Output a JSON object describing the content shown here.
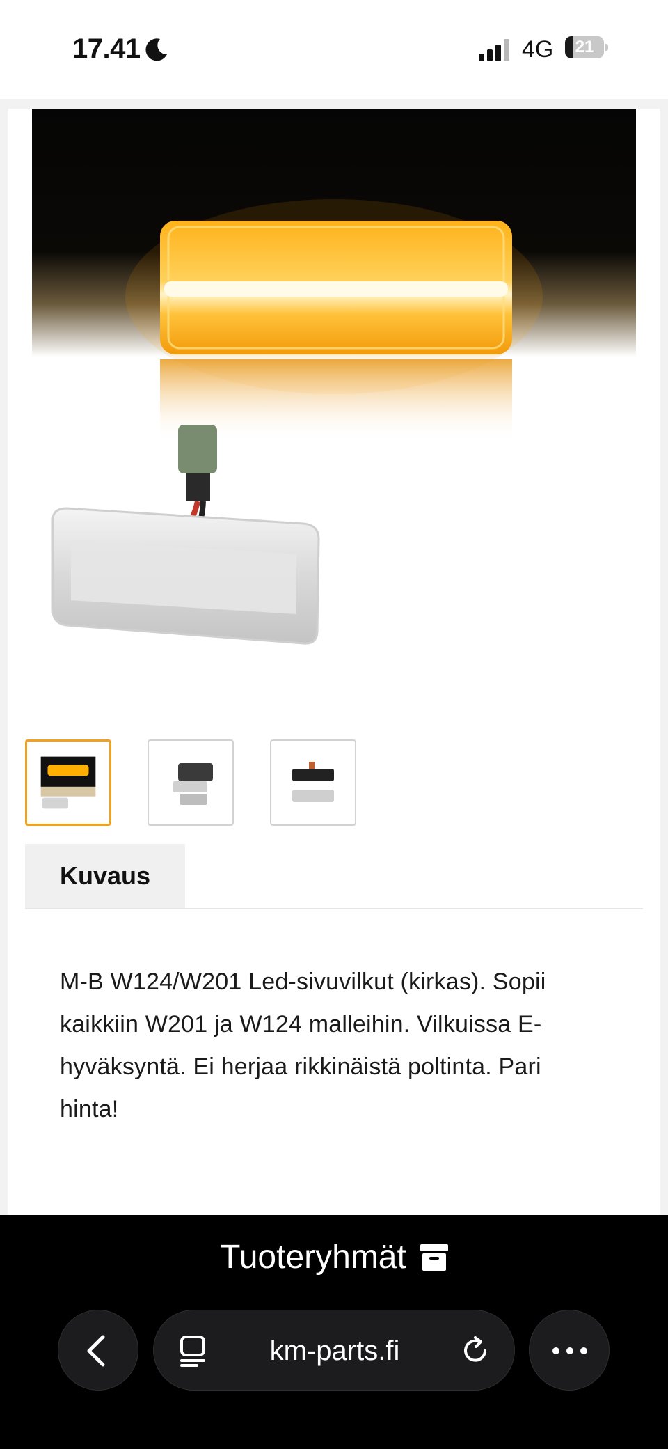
{
  "status_bar": {
    "time": "17.41",
    "network": "4G",
    "battery_level": "21",
    "battery_fraction": 0.21,
    "icons": [
      "moon-icon",
      "signal-bars-icon",
      "battery-icon"
    ]
  },
  "product": {
    "image_icon": "side-indicator-lamp-photo",
    "thumbnails": [
      {
        "name": "thumbnail-1",
        "selected": true
      },
      {
        "name": "thumbnail-2",
        "selected": false
      },
      {
        "name": "thumbnail-3",
        "selected": false
      }
    ],
    "tabs": [
      {
        "label": "Kuvaus",
        "active": true
      }
    ],
    "description": "M-B W124/W201 Led-sivuvilkut (kirkas). Sopii kaikkiin W201 ja W124 malleihin. Vilkuissa E-hyväksyntä. Ei herjaa rikkinäistä poltinta. Pari hinta!"
  },
  "bottom_bar": {
    "categories_label": "Tuoteryhmät",
    "categories_icon": "archive-box-icon",
    "url": "km-parts.fi",
    "icons": [
      "back-icon",
      "tabs-icon",
      "reload-icon",
      "more-icon"
    ]
  },
  "colors": {
    "accent_orange": "#f0a21e",
    "amber_light": "#ffb000",
    "bar_background": "#000000"
  }
}
